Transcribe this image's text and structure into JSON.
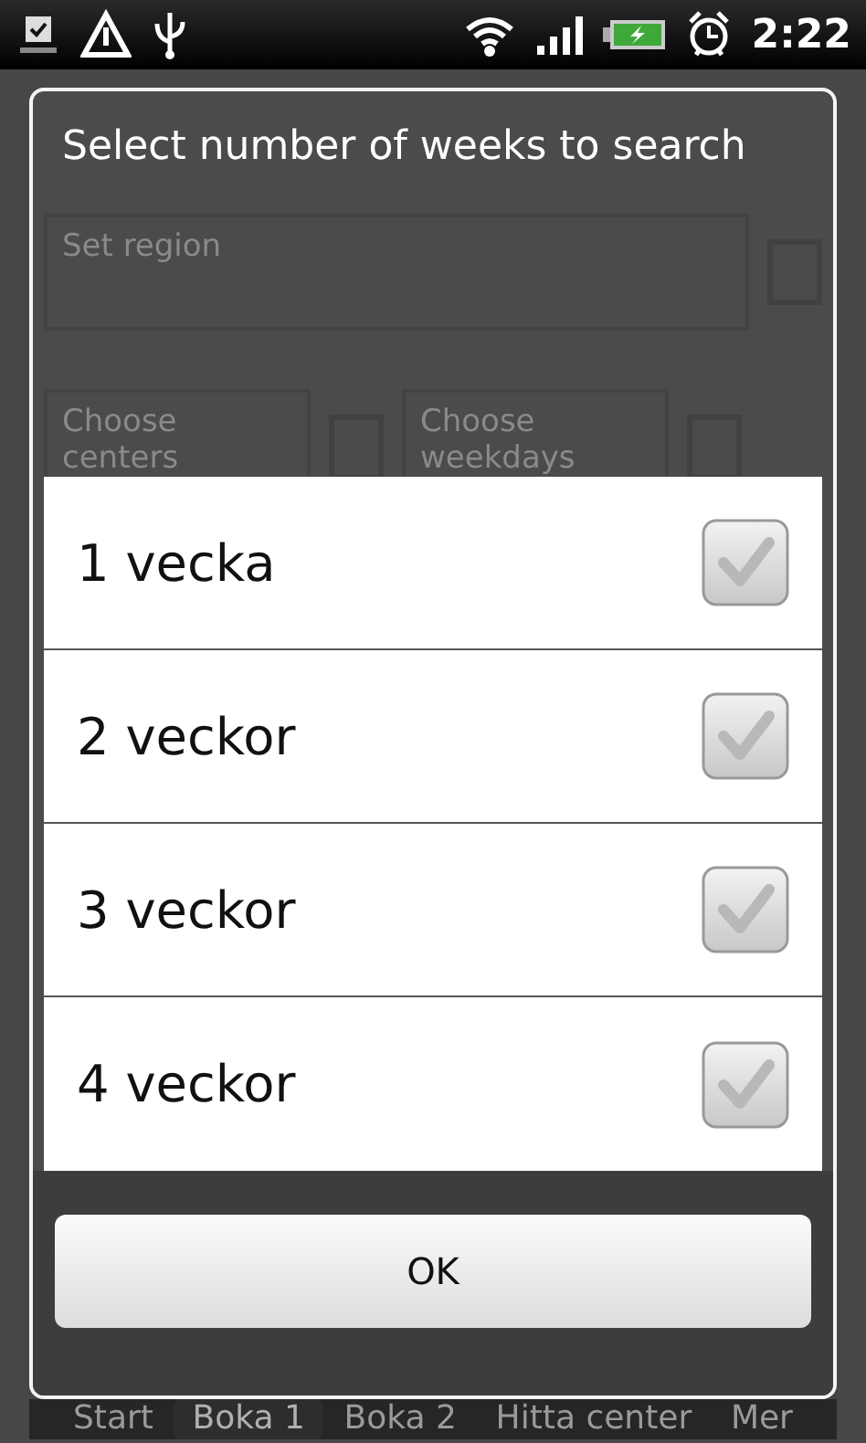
{
  "status_bar": {
    "time": "2:22"
  },
  "background": {
    "fields": [
      {
        "label": "Set region"
      },
      {
        "label": "Choose centers"
      },
      {
        "label": "Choose weekdays"
      }
    ],
    "tabs": [
      {
        "label": "Start",
        "selected": false
      },
      {
        "label": "Boka 1",
        "selected": true
      },
      {
        "label": "Boka 2",
        "selected": false
      },
      {
        "label": "Hitta center",
        "selected": false
      },
      {
        "label": "Mer",
        "selected": false
      }
    ]
  },
  "dialog": {
    "title": "Select number of weeks to search",
    "options": [
      {
        "label": "1 vecka",
        "checked": false
      },
      {
        "label": "2 veckor",
        "checked": false
      },
      {
        "label": "3 veckor",
        "checked": false
      },
      {
        "label": "4 veckor",
        "checked": false
      }
    ],
    "button": "OK"
  }
}
